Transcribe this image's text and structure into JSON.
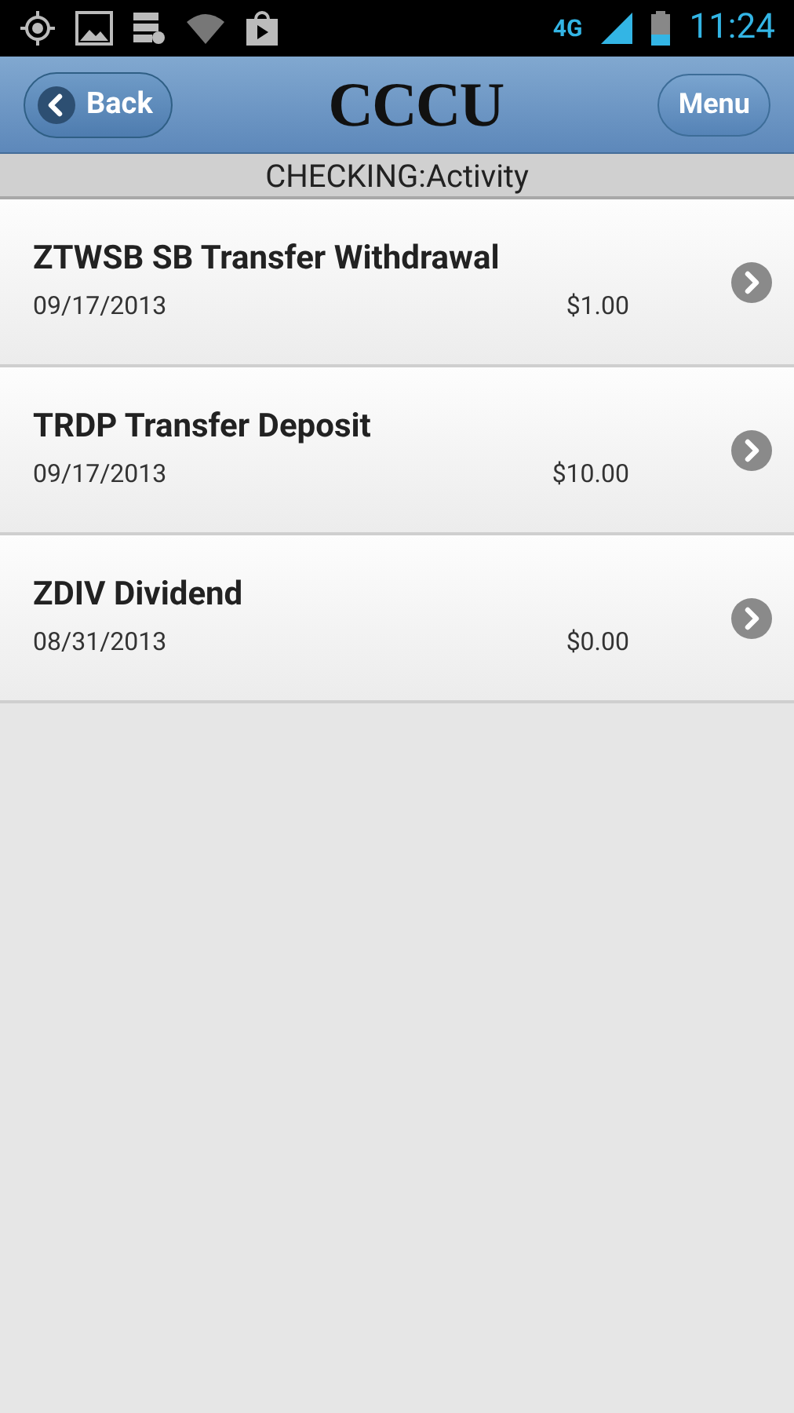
{
  "status_bar": {
    "network": "4G",
    "time": "11:24"
  },
  "header": {
    "back_button": "Back",
    "title": "CCCU",
    "menu_button": "Menu"
  },
  "subheader": "CHECKING:Activity",
  "transactions": [
    {
      "description": "ZTWSB SB Transfer Withdrawal",
      "date": "09/17/2013",
      "amount": "$1.00"
    },
    {
      "description": "TRDP Transfer Deposit",
      "date": "09/17/2013",
      "amount": "$10.00"
    },
    {
      "description": "ZDIV Dividend",
      "date": "08/31/2013",
      "amount": "$0.00"
    }
  ]
}
